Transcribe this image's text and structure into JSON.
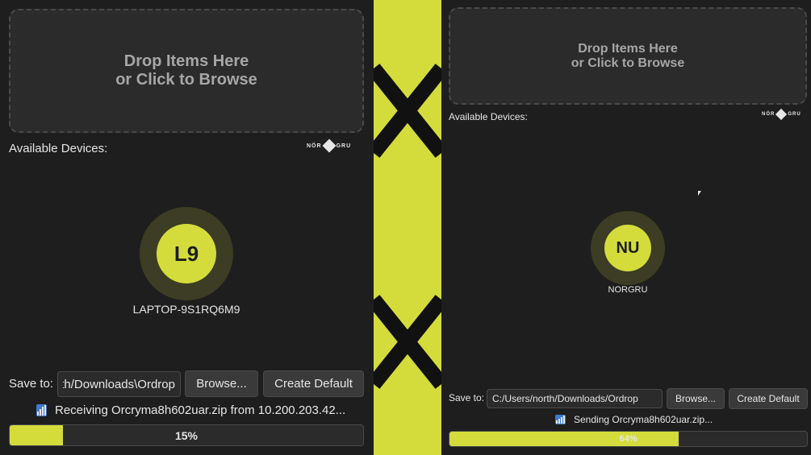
{
  "left": {
    "dropzone": {
      "line1": "Drop Items Here",
      "line2": "or Click to Browse"
    },
    "devices_label": "Available Devices:",
    "logo": {
      "left": "NÖR",
      "right": "GRU"
    },
    "device": {
      "initials": "L9",
      "name": "LAPTOP-9S1RQ6M9"
    },
    "save_label": "Save to:",
    "save_path": "C:/Users/north/Downloads\\Ordrop",
    "browse_label": "Browse...",
    "default_label": "Create Default",
    "status": "Receiving Orcryma8h602uar.zip from 10.200.203.42...",
    "progress": {
      "fraction": 0.15,
      "label": "15%"
    }
  },
  "right": {
    "dropzone": {
      "line1": "Drop Items Here",
      "line2": "or Click to Browse"
    },
    "devices_label": "Available Devices:",
    "logo": {
      "left": "NÖR",
      "right": "GRU"
    },
    "device": {
      "initials": "NU",
      "name": "NORGRU"
    },
    "save_label": "Save to:",
    "save_path": "C:/Users/north/Downloads/Ordrop",
    "browse_label": "Browse...",
    "default_label": "Create Default",
    "status": "Sending Orcryma8h602uar.zip...",
    "progress": {
      "fraction": 0.64,
      "label": "64%"
    }
  },
  "colors": {
    "accent": "#d4dc3c",
    "background": "#1e1e1e",
    "panel": "#2b2b2b",
    "ring": "#3c3d24",
    "text": "#e6e6e6",
    "muted": "#a6a6a6"
  },
  "icons": {
    "signal": "signal-bars-icon",
    "logo": "norgru-logo-icon",
    "divider": "cross-pattern"
  }
}
